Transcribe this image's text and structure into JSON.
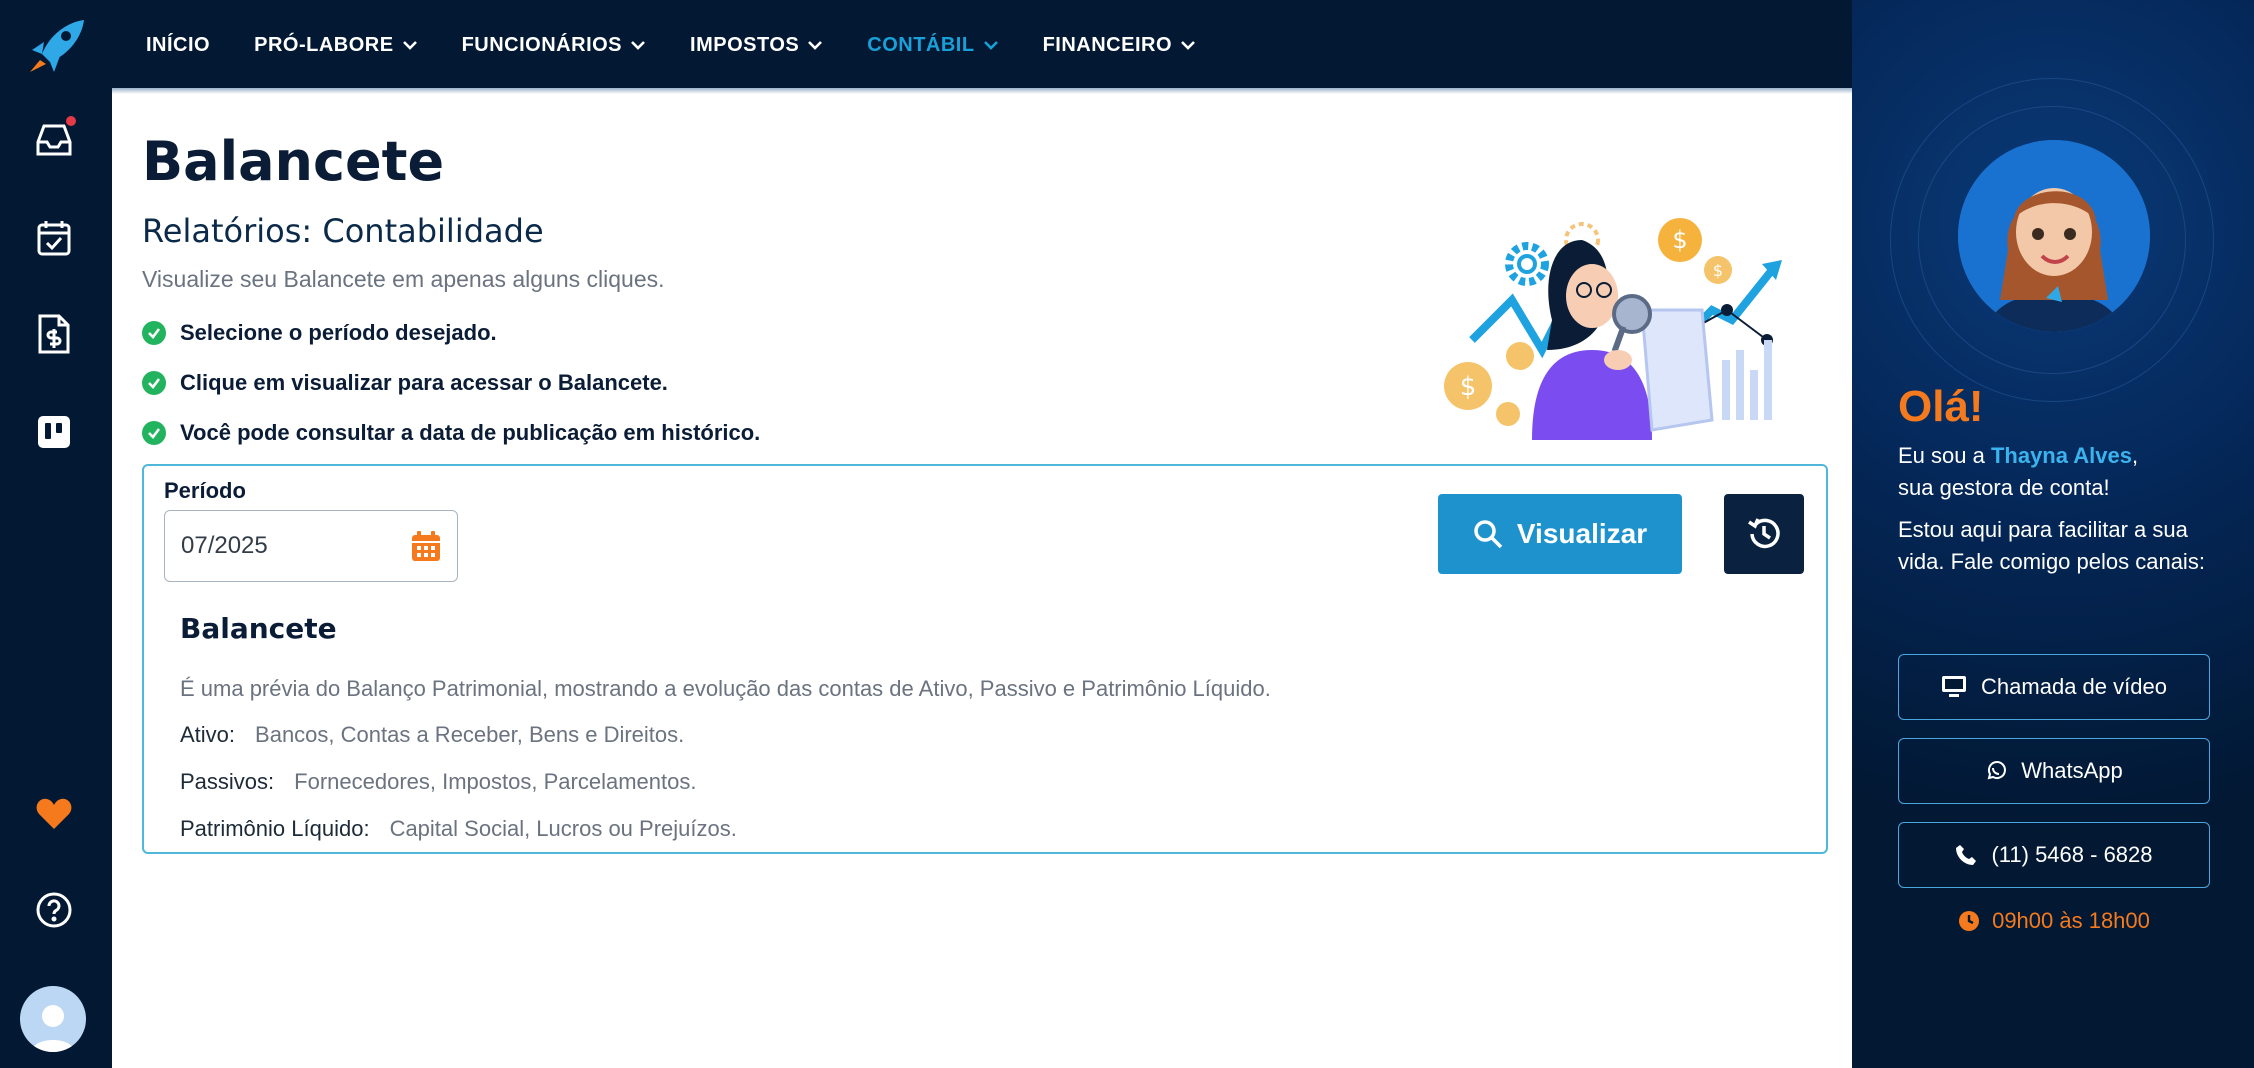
{
  "nav": {
    "items": [
      {
        "label": "INÍCIO",
        "has_dropdown": false,
        "active": false
      },
      {
        "label": "PRÓ-LABORE",
        "has_dropdown": true,
        "active": false
      },
      {
        "label": "FUNCIONÁRIOS",
        "has_dropdown": true,
        "active": false
      },
      {
        "label": "IMPOSTOS",
        "has_dropdown": true,
        "active": false
      },
      {
        "label": "CONTÁBIL",
        "has_dropdown": true,
        "active": true
      },
      {
        "label": "FINANCEIRO",
        "has_dropdown": true,
        "active": false
      }
    ]
  },
  "sidebar": {
    "icons": [
      "rocket-logo-icon",
      "inbox-icon",
      "calendar-check-icon",
      "invoice-dollar-icon",
      "board-icon",
      "heart-icon",
      "help-icon",
      "user-avatar-icon"
    ],
    "inbox_has_notification": true
  },
  "page": {
    "title": "Balancete",
    "subtitle": "Relatórios: Contabilidade",
    "description": "Visualize seu Balancete em apenas alguns cliques.",
    "steps": [
      "Selecione o período desejado.",
      "Clique em visualizar para acessar o Balancete.",
      "Você pode consultar a data de publicação em histórico."
    ]
  },
  "form": {
    "period_label": "Período",
    "period_value": "07/2025",
    "visualizar_label": "Visualizar"
  },
  "info": {
    "title": "Balancete",
    "description": "É uma prévia do Balanço Patrimonial, mostrando a evolução das contas de Ativo, Passivo e Patrimônio Líquido.",
    "rows": [
      {
        "key": "Ativo:",
        "value": "Bancos, Contas a Receber, Bens e Direitos."
      },
      {
        "key": "Passivos:",
        "value": "Fornecedores, Impostos, Parcelamentos."
      },
      {
        "key": "Patrimônio Líquido:",
        "value": "Capital Social, Lucros ou Prejuízos."
      }
    ]
  },
  "manager": {
    "greeting": "Olá!",
    "intro_prefix": "Eu sou a ",
    "name": "Thayna Alves",
    "intro_suffix": ",",
    "intro_line2": "sua gestora de conta!",
    "message": "Estou aqui para facilitar a sua vida. Fale comigo pelos canais:",
    "video_label": "Chamada de vídeo",
    "whatsapp_label": "WhatsApp",
    "phone_label": "(11) 5468 - 6828",
    "hours": "09h00 às 18h00"
  },
  "colors": {
    "sidebar_bg": "#021833",
    "accent_blue": "#1e92cc",
    "active_nav": "#1aa0d8",
    "orange": "#f57a1d",
    "check_green": "#22b35e"
  }
}
